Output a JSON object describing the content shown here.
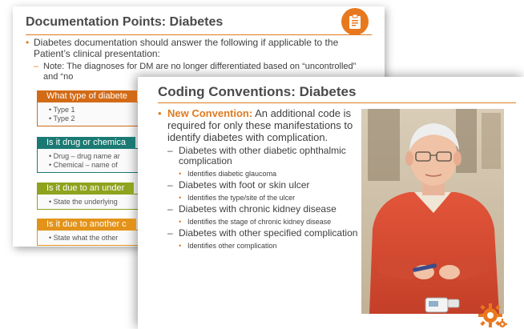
{
  "slide_back": {
    "title": "Documentation Points: Diabetes",
    "bullet": "Diabetes documentation should answer  the following  if applicable to the Patient’s clinical presentation:",
    "note": "Note: The diagnoses for DM are no longer differentiated based on “uncontrolled” and “no",
    "boxes": [
      {
        "header": "What type of diabete",
        "color": "orange",
        "items": [
          "Type 1",
          "Type 2"
        ]
      },
      {
        "header": "Is it drug or chemica",
        "color": "teal",
        "items": [
          "Drug – drug name ar",
          "Chemical – name of"
        ]
      },
      {
        "header": "Is it due to an under",
        "color": "olive",
        "items": [
          "State the underlying"
        ]
      },
      {
        "header": "Is it due to another c",
        "color": "gold",
        "items": [
          "State what the other"
        ]
      }
    ]
  },
  "slide_front": {
    "title": "Coding Conventions: Diabetes",
    "convention_label": "New Convention:",
    "convention_text": " An additional code is required  for only these manifestations to identify diabetes with complication.",
    "items": [
      {
        "text": "Diabetes with other diabetic ophthalmic complication",
        "sub": "Identifies diabetic glaucoma"
      },
      {
        "text": "Diabetes with foot or skin ulcer",
        "sub": "Identifies the type/site of the ulcer"
      },
      {
        "text": "Diabetes with chronic kidney disease",
        "sub": "Identifies the stage of chronic kidney disease"
      },
      {
        "text": "Diabetes with other specified complication",
        "sub": "Identifies other complication"
      }
    ]
  },
  "colors": {
    "accent": "#e07a1f",
    "orange": "#d26a16",
    "teal": "#1a7a73",
    "olive": "#8fa31e",
    "gold": "#e3931a"
  },
  "icons": [
    "clipboard-icon",
    "gear-icon"
  ]
}
